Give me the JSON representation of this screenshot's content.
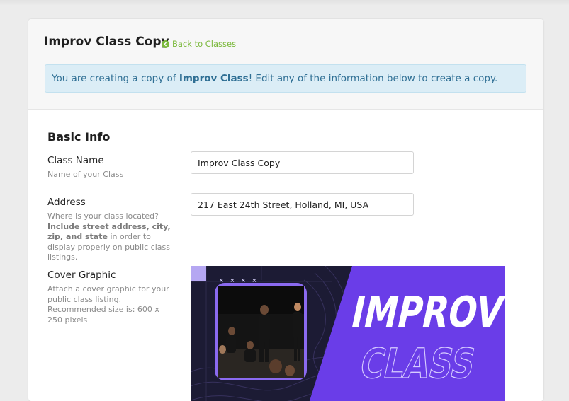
{
  "header": {
    "title": "Improv Class Copy",
    "back_link": "Back to Classes"
  },
  "alert": {
    "prefix": "You are creating a copy of ",
    "class_name": "Improv Class",
    "suffix": "! Edit any of the information below to create a copy."
  },
  "form": {
    "section_title": "Basic Info",
    "class_name": {
      "label": "Class Name",
      "help": "Name of your Class",
      "value": "Improv Class Copy"
    },
    "address": {
      "label": "Address",
      "help_prefix": "Where is your class located? ",
      "help_bold": "Include street address, city, zip, and state",
      "help_suffix": " in order to display properly on public class listings.",
      "value": "217 East 24th Street, Holland, MI, USA"
    },
    "cover": {
      "label": "Cover Graphic",
      "help": "Attach a cover graphic for your public class listing. Recommended size is: 600 x 250 pixels",
      "image_text_1": "IMPROV",
      "image_text_2": "CLASS",
      "image_marks": "× × × ×"
    }
  },
  "colors": {
    "link_green": "#7ab83a",
    "alert_bg": "#dbedf6",
    "alert_text": "#2f6f94",
    "cover_purple": "#6a3de8",
    "cover_dark": "#1c1b34"
  },
  "icons": {
    "back": "arrow-left-circle-icon"
  }
}
